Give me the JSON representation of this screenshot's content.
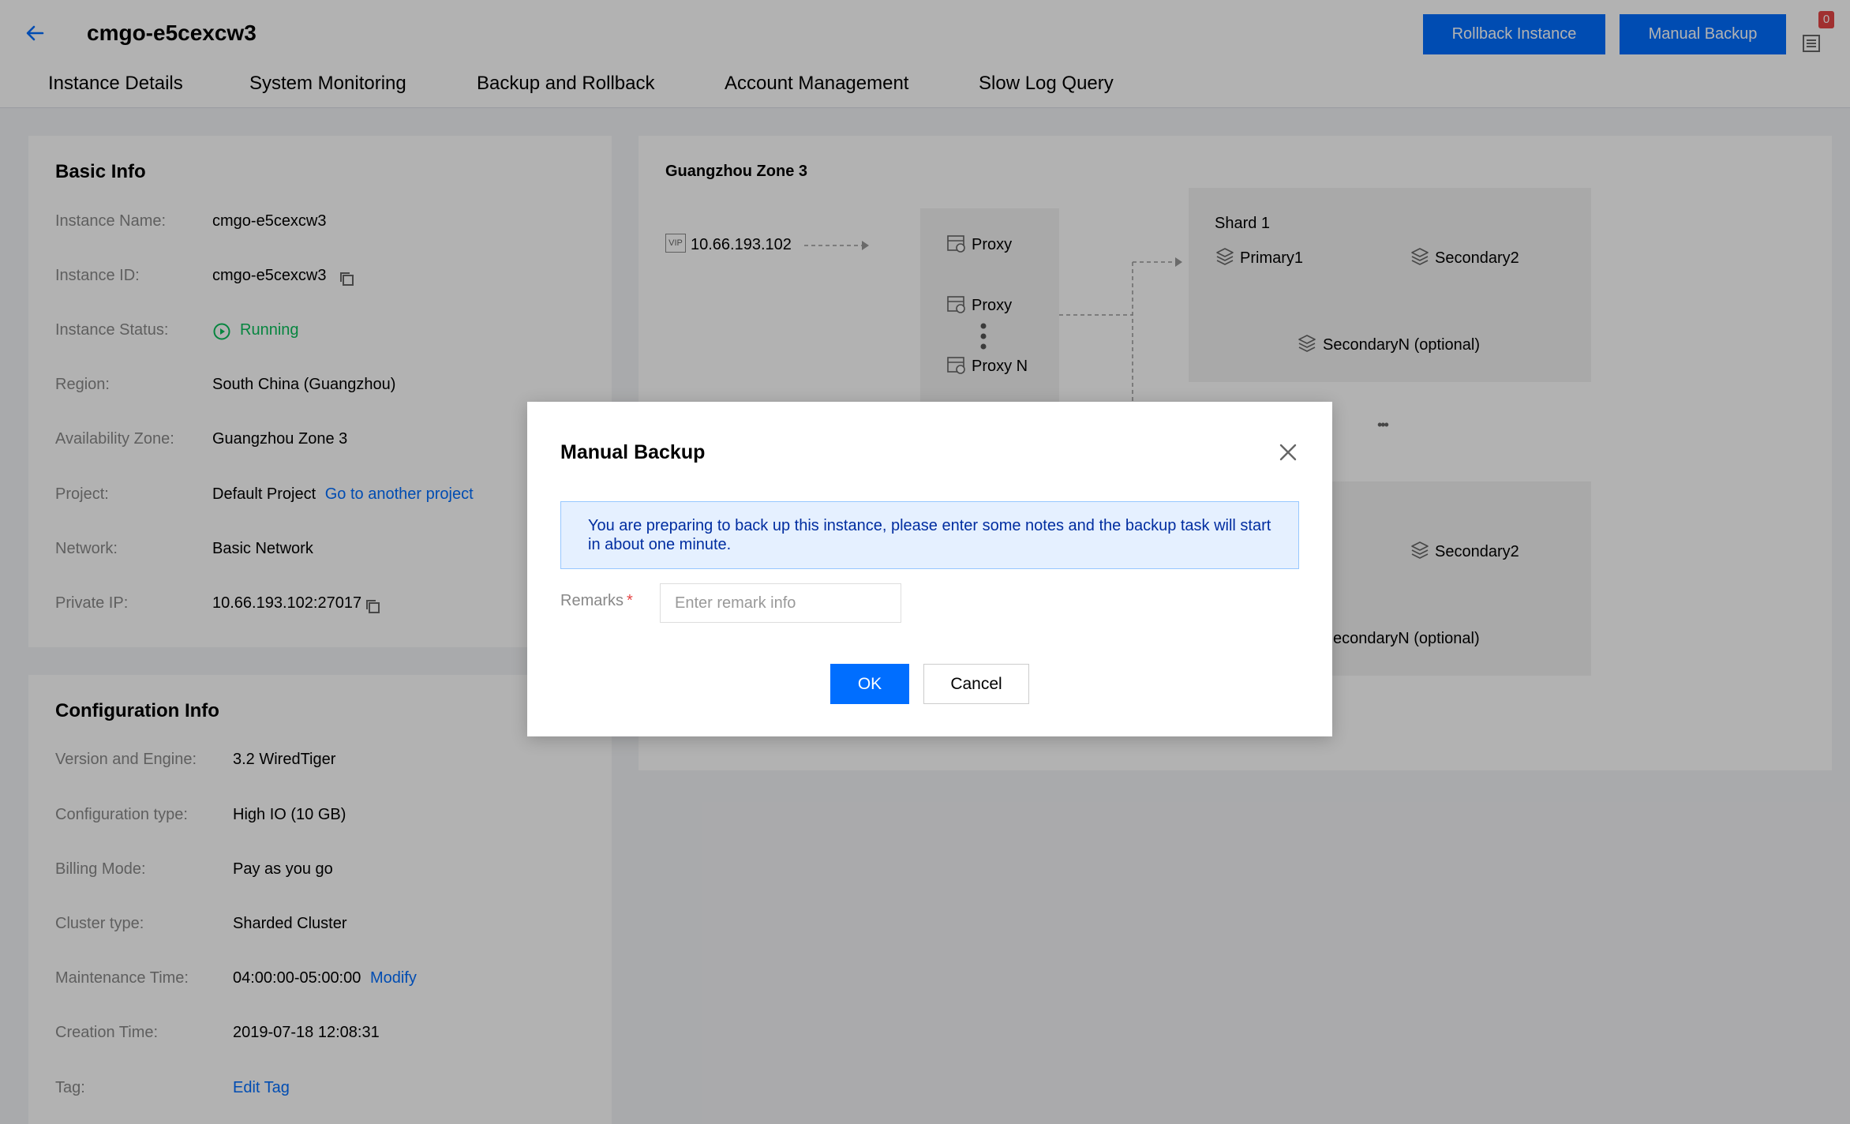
{
  "header": {
    "title": "cmgo-e5cexcw3",
    "rollback_label": "Rollback Instance",
    "manual_backup_label": "Manual Backup",
    "notification_count": "0",
    "icons": {
      "back": "arrow-left-icon",
      "notifications": "list-icon"
    }
  },
  "tabs": [
    {
      "label": "Instance Details"
    },
    {
      "label": "System Monitoring"
    },
    {
      "label": "Backup and Rollback"
    },
    {
      "label": "Account Management"
    },
    {
      "label": "Slow Log Query"
    }
  ],
  "basic_info": {
    "title": "Basic Info",
    "rows": [
      {
        "label": "Instance Name:",
        "value": "cmgo-e5cexcw3"
      },
      {
        "label": "Instance ID:",
        "value": "cmgo-e5cexcw3"
      },
      {
        "label": "Instance Status:",
        "value": "Running"
      },
      {
        "label": "Region:",
        "value": "South China (Guangzhou)"
      },
      {
        "label": "Availability Zone:",
        "value": "Guangzhou Zone 3"
      },
      {
        "label": "Project:",
        "value": "Default Project",
        "link": "Go to another project"
      },
      {
        "label": "Network:",
        "value": "Basic Network"
      },
      {
        "label": "Private IP:",
        "value": "10.66.193.102:27017"
      }
    ]
  },
  "config_info": {
    "title": "Configuration Info",
    "rows": [
      {
        "label": "Version and Engine:",
        "value": "3.2 WiredTiger"
      },
      {
        "label": "Configuration type:",
        "value": "High IO (10 GB)"
      },
      {
        "label": "Billing Mode:",
        "value": "Pay as you go"
      },
      {
        "label": "Cluster type:",
        "value": "Sharded Cluster"
      },
      {
        "label": "Maintenance Time:",
        "value": "04:00:00-05:00:00",
        "link": "Modify"
      },
      {
        "label": "Creation Time:",
        "value": "2019-07-18 12:08:31"
      },
      {
        "label": "Tag:",
        "value": "",
        "link": "Edit Tag"
      }
    ]
  },
  "topology": {
    "zone": "Guangzhou Zone 3",
    "vip_badge": "VIP",
    "vip": "10.66.193.102",
    "proxies": [
      "Proxy",
      "Proxy",
      "Proxy N"
    ],
    "shard1": {
      "title": "Shard 1",
      "primary": "Primary1",
      "secondary": "Secondary2",
      "secondary_n": "SecondaryN (optional)"
    },
    "shard2": {
      "secondary": "Secondary2",
      "secondary_n": "econdaryN (optional)"
    },
    "ellipsis": "•••"
  },
  "colors": {
    "accent": "#006eff",
    "running": "#0abf5b",
    "danger": "#e54545"
  },
  "dialog": {
    "title": "Manual Backup",
    "info": "You are preparing to back up this instance, please enter some notes and the backup task will start in about one minute.",
    "remarks_label": "Remarks",
    "required_mark": "*",
    "remarks_placeholder": "Enter remark info",
    "remarks_value": "",
    "ok_label": "OK",
    "cancel_label": "Cancel"
  }
}
